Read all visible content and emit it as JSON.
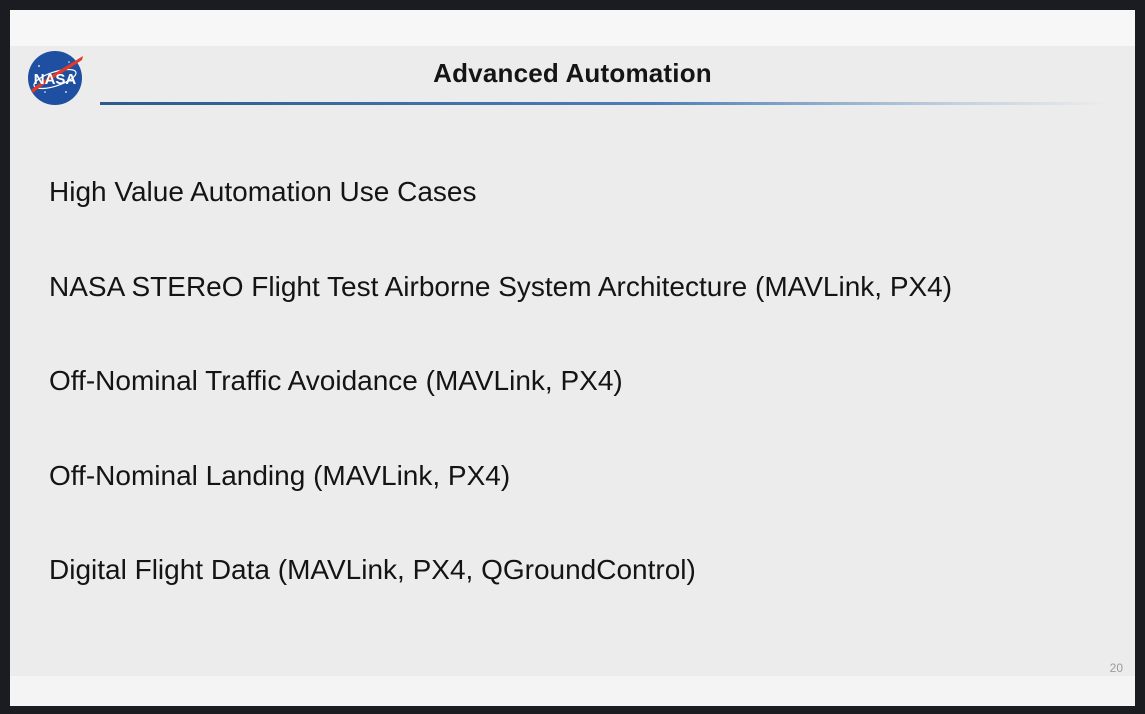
{
  "slide": {
    "title": "Advanced Automation",
    "logo_icon": "nasa-meatball-logo",
    "accent_color": "#2e5a8c",
    "bullets": [
      "High Value Automation Use Cases",
      "NASA STEReO Flight Test Airborne System Architecture (MAVLink, PX4)",
      "Off-Nominal Traffic Avoidance (MAVLink, PX4)",
      "Off-Nominal Landing (MAVLink, PX4)",
      "Digital Flight Data (MAVLink, PX4, QGroundControl)"
    ],
    "page_number": "20"
  },
  "logo": {
    "text": "NASA",
    "colors": {
      "blue": "#1f4fa0",
      "red": "#e03a2a",
      "white": "#ffffff"
    }
  }
}
